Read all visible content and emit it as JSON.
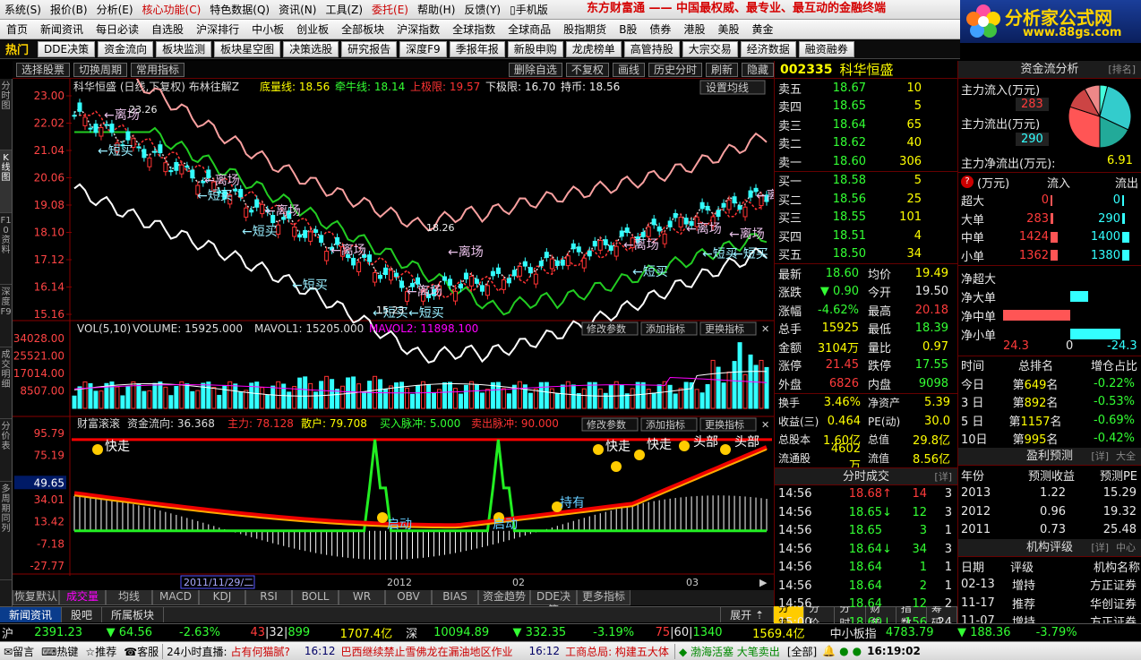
{
  "menu": [
    "系统(S)",
    "报价(B)",
    "分析(E)",
    "核心功能(C)",
    "特色数据(Q)",
    "资讯(N)",
    "工具(Z)",
    "委托(E)",
    "帮助(H)",
    "反馈(Y)",
    "手机版"
  ],
  "slogan": "东方财富通 —— 中国最权威、最专业、最互动的金融终端",
  "logo": {
    "title": "分析家公式网",
    "url": "www.88gs.com"
  },
  "nav1": [
    "首页",
    "新闻资讯",
    "每日必读",
    "自选股",
    "沪深排行",
    "中小板",
    "创业板",
    "全部板块",
    "沪深指数",
    "全球指数",
    "全球商品",
    "股指期货",
    "B股",
    "债券",
    "港股",
    "美股",
    "黄金"
  ],
  "nav2_hot": "热门",
  "nav2": [
    "DDE决策",
    "资金流向",
    "板块监测",
    "板块星空图",
    "决策选股",
    "研究报告",
    "深度F9",
    "季报年报",
    "新股申购",
    "龙虎榜单",
    "高管持股",
    "大宗交易",
    "经济数据",
    "融资融券"
  ],
  "lefttabs": [
    "分时图",
    "K线图",
    "F10资料",
    "深度F9",
    "成交明细",
    "分价表",
    "多周期同列"
  ],
  "charttop": {
    "left": [
      "选择股票",
      "切换周期",
      "常用指标"
    ],
    "right": [
      "删除自选",
      "不复权",
      "画线",
      "历史分时",
      "刷新",
      "隐藏"
    ]
  },
  "kline": {
    "title": "科华恒盛 (日线,下复权) 布林往解Z",
    "labels": [
      {
        "t": "底量线: 18.56",
        "c": "#ff0"
      },
      {
        "t": "牵牛线: 18.14",
        "c": "#3f3"
      },
      {
        "t": "上极限: 19.57",
        "c": "#f33"
      },
      {
        "t": "下极限: 16.70",
        "c": "#eee"
      },
      {
        "t": "持币: 18.56",
        "c": "#eee"
      }
    ],
    "setbtn": "设置均线",
    "yticks": [
      "23.00",
      "22.02",
      "21.04",
      "20.06",
      "19.08",
      "18.10",
      "17.12",
      "16.14",
      "15.16"
    ],
    "peak_hi": "23.26",
    "peak_mid": "18.26",
    "low": "15.23",
    "ann_left": "离场",
    "ann_short": "短买",
    "ann_zl": "短买"
  },
  "volume": {
    "label": "VOL(5,10)",
    "vol": "VOLUME: 15925.000",
    "ma1": "MAVOL1: 15205.000",
    "ma2": "MAVOL2: 11898.100",
    "yticks": [
      "34028.00",
      "25521.00",
      "17014.00",
      "8507.00"
    ],
    "buttons": [
      "修改参数",
      "添加指标",
      "更换指标"
    ]
  },
  "indicator": {
    "name": "财富滚滚",
    "flow": "资金流向: 36.368",
    "zl": "主力: 78.128",
    "sh": "散户: 79.708",
    "buy": "买入脉冲: 5.000",
    "sell": "卖出脉冲: 90.000",
    "yticks": [
      "95.79",
      "75.19",
      "49.65",
      "34.01",
      "13.42",
      "-7.18",
      "-27.77"
    ],
    "ann_fast": "快走",
    "ann_move": "启动",
    "ann_hold": "持有",
    "ann_head": "头部"
  },
  "xaxis": {
    "cur": "2011/11/29/二",
    "labels": [
      "2012",
      "02",
      "03"
    ]
  },
  "bottomtabs": [
    "恢复默认",
    "成交量",
    "均线",
    "MACD",
    "KDJ",
    "RSI",
    "BOLL",
    "WR",
    "OBV",
    "BIAS",
    "资金趋势",
    "DDE决策",
    "更多指标"
  ],
  "stock": {
    "code": "002335",
    "name": "科华恒盛"
  },
  "sells": [
    {
      "l": "卖五",
      "p": "18.67",
      "v": "10"
    },
    {
      "l": "卖四",
      "p": "18.65",
      "v": "5"
    },
    {
      "l": "卖三",
      "p": "18.64",
      "v": "65"
    },
    {
      "l": "卖二",
      "p": "18.62",
      "v": "40"
    },
    {
      "l": "卖一",
      "p": "18.60",
      "v": "306"
    }
  ],
  "buys": [
    {
      "l": "买一",
      "p": "18.58",
      "v": "5"
    },
    {
      "l": "买二",
      "p": "18.56",
      "v": "25"
    },
    {
      "l": "买三",
      "p": "18.55",
      "v": "101"
    },
    {
      "l": "买四",
      "p": "18.51",
      "v": "4"
    },
    {
      "l": "买五",
      "p": "18.50",
      "v": "34"
    }
  ],
  "quote": [
    [
      {
        "l": "最新",
        "v": "18.60",
        "vc": "g"
      },
      {
        "l": "均价",
        "v": "19.49",
        "vc": "y"
      }
    ],
    [
      {
        "l": "涨跌",
        "v": "▼ 0.90",
        "vc": "g"
      },
      {
        "l": "今开",
        "v": "19.50",
        "vc": "w"
      }
    ],
    [
      {
        "l": "涨幅",
        "v": "-4.62%",
        "vc": "g"
      },
      {
        "l": "最高",
        "v": "20.18",
        "vc": "r"
      }
    ],
    [
      {
        "l": "总手",
        "v": "15925",
        "vc": "y"
      },
      {
        "l": "最低",
        "v": "18.39",
        "vc": "g"
      }
    ],
    [
      {
        "l": "金额",
        "v": "3104万",
        "vc": "y"
      },
      {
        "l": "量比",
        "v": "0.97",
        "vc": "y"
      }
    ],
    [
      {
        "l": "涨停",
        "v": "21.45",
        "vc": "r"
      },
      {
        "l": "跌停",
        "v": "17.55",
        "vc": "g"
      }
    ],
    [
      {
        "l": "外盘",
        "v": "6826",
        "vc": "r"
      },
      {
        "l": "内盘",
        "v": "9098",
        "vc": "g"
      }
    ]
  ],
  "fund": [
    [
      {
        "l": "换手",
        "v": "3.46%"
      },
      {
        "l": "净资产",
        "v": "5.39"
      }
    ],
    [
      {
        "l": "收益(三)",
        "v": "0.464"
      },
      {
        "l": "PE(动)",
        "v": "30.0"
      }
    ],
    [
      {
        "l": "总股本",
        "v": "1.60亿"
      },
      {
        "l": "总值",
        "v": "29.8亿"
      }
    ],
    [
      {
        "l": "流通股",
        "v": "4602万"
      },
      {
        "l": "流值",
        "v": "8.56亿"
      }
    ]
  ],
  "ticks": {
    "title": "分时成交",
    "detail": "[详]",
    "rows": [
      {
        "t": "14:56",
        "p": "18.68",
        "a": "↑",
        "v": "14",
        "n": "3"
      },
      {
        "t": "14:56",
        "p": "18.65",
        "a": "↓",
        "v": "12",
        "n": "3"
      },
      {
        "t": "14:56",
        "p": "18.65",
        "a": "",
        "v": "3",
        "n": "1"
      },
      {
        "t": "14:56",
        "p": "18.64",
        "a": "↓",
        "v": "34",
        "n": "3"
      },
      {
        "t": "14:56",
        "p": "18.64",
        "a": "",
        "v": "1",
        "n": "1"
      },
      {
        "t": "14:56",
        "p": "18.64",
        "a": "",
        "v": "2",
        "n": "1"
      },
      {
        "t": "14:56",
        "p": "18.64",
        "a": "",
        "v": "12",
        "n": "2"
      },
      {
        "t": "15:00",
        "p": "18.60",
        "a": "↓",
        "v": "156",
        "n": "24"
      }
    ]
  },
  "rtabs": [
    "分笔",
    "分价",
    "分时",
    "财务",
    "指数",
    "筹码"
  ],
  "flow": {
    "title": "资金流分析",
    "rank": "[排名]",
    "in_label": "主力流入(万元)",
    "in_val": "283",
    "out_label": "主力流出(万元)",
    "out_val": "290",
    "net_label": "主力净流出(万元):",
    "net_val": "6.91",
    "unit": "(万元)",
    "col_in": "流入",
    "col_out": "流出",
    "rows": [
      {
        "l": "超大",
        "in": "0",
        "out": "0",
        "bi": 0,
        "bo": 0
      },
      {
        "l": "大单",
        "in": "283",
        "out": "290",
        "bi": 0.2,
        "bo": 0.21
      },
      {
        "l": "中单",
        "in": "1424",
        "out": "1400",
        "bi": 1,
        "bo": 0.98
      },
      {
        "l": "小单",
        "in": "1362",
        "out": "1380",
        "bi": 0.96,
        "bo": 0.97
      }
    ],
    "net_rows": [
      {
        "l": "净超大",
        "v": 0
      },
      {
        "l": "净大单",
        "v": -0.27
      },
      {
        "l": "净中单",
        "v": 1
      },
      {
        "l": "净小单",
        "v": -0.75
      }
    ],
    "net_axis": [
      "24.3",
      "0",
      "-24.3"
    ]
  },
  "rank": {
    "h": [
      "时间",
      "总排名",
      "增仓占比"
    ],
    "rows": [
      {
        "t": "今日",
        "r": "第649名",
        "v": "-0.22%"
      },
      {
        "t": "3 日",
        "r": "第892名",
        "v": "-0.53%"
      },
      {
        "t": "5 日",
        "r": "第1157名",
        "v": "-0.69%"
      },
      {
        "t": "10日",
        "r": "第995名",
        "v": "-0.42%"
      }
    ]
  },
  "forecast": {
    "title": "盈利预测",
    "detail": "[详]",
    "big": "大全",
    "h": [
      "年份",
      "预测收益",
      "预测PE"
    ],
    "rows": [
      {
        "y": "2013",
        "e": "1.22",
        "pe": "15.29"
      },
      {
        "y": "2012",
        "e": "0.96",
        "pe": "19.32"
      },
      {
        "y": "2011",
        "e": "0.73",
        "pe": "25.48"
      }
    ]
  },
  "rating": {
    "title": "机构评级",
    "detail": "[详]",
    "center": "中心",
    "h": [
      "日期",
      "评级",
      "机构名称"
    ],
    "rows": [
      {
        "d": "02-13",
        "r": "增持",
        "n": "方正证券"
      },
      {
        "d": "11-17",
        "r": "推荐",
        "n": "华创证券"
      },
      {
        "d": "11-07",
        "r": "增持",
        "n": "方正证券"
      }
    ]
  },
  "newsbar": [
    "新闻资讯",
    "股吧",
    "所属板块"
  ],
  "expand": "展开",
  "status1": {
    "sh": "沪",
    "sh_idx": "2391.23",
    "sh_chg": "▼ 64.56",
    "sh_pct": "-2.63%",
    "sh_up": "43",
    "sh_eq": "32",
    "sh_dn": "899",
    "sh_amt": "1707.4亿",
    "sz": "深",
    "sz_idx": "10094.89",
    "sz_chg": "▼ 332.35",
    "sz_pct": "-3.19%",
    "sz_up": "75",
    "sz_eq": "60",
    "sz_dn": "1340",
    "sz_amt": "1569.4亿",
    "zx": "中小板指",
    "zx_idx": "4783.79",
    "zx_chg": "▼ 188.36",
    "zx_pct": "-3.79%"
  },
  "status2": {
    "items": [
      "留言",
      "热键",
      "推荐",
      "客服"
    ],
    "live": "24小时直播:",
    "q": "占有何猫腻?",
    "t1": "16:12",
    "n1": "巴西继续禁止雪佛龙在漏油地区作业",
    "t2": "16:12",
    "n2": "工商总局: 构建五大体",
    "ticker": "渤海活塞  大笔卖出",
    "all": "[全部]",
    "clock": "16:19:02"
  }
}
